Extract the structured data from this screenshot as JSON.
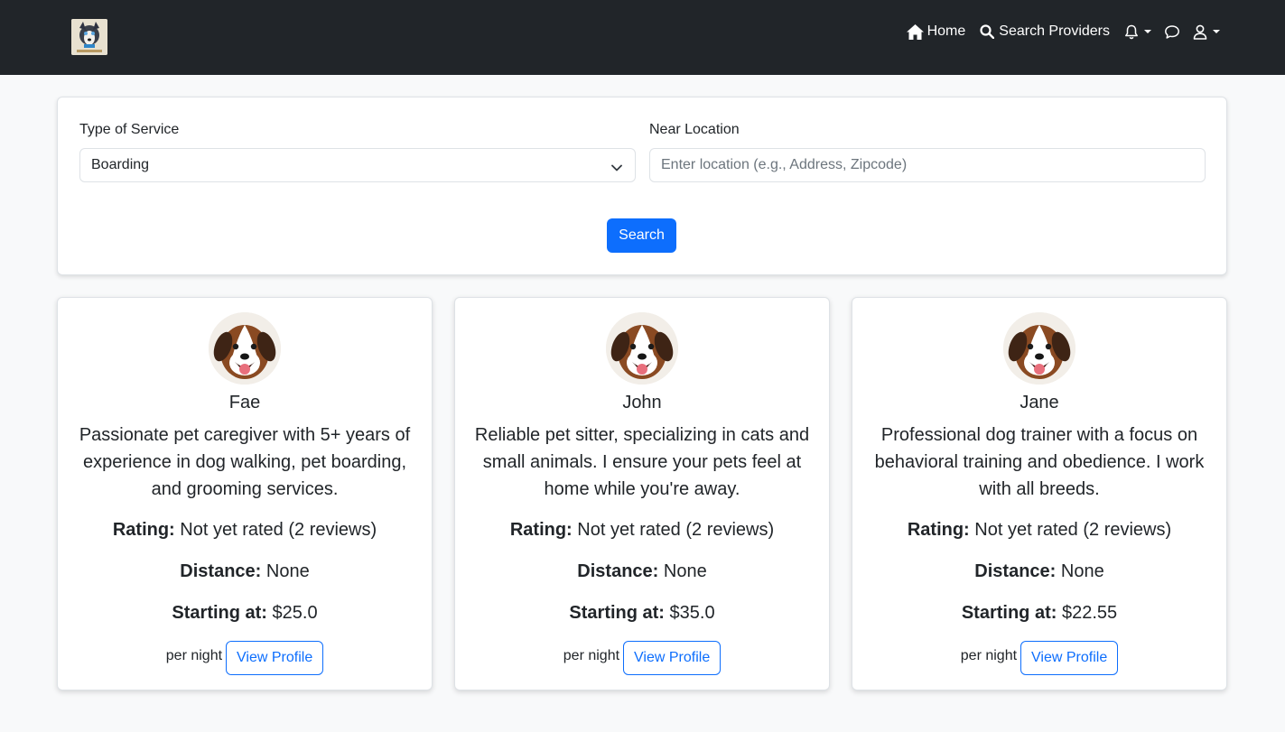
{
  "nav": {
    "home_label": "Home",
    "search_label": "Search Providers",
    "icons": [
      "home-icon",
      "search-icon",
      "bell-icon",
      "chat-icon",
      "user-icon"
    ]
  },
  "search": {
    "service_label": "Type of Service",
    "service_value": "Boarding",
    "location_label": "Near Location",
    "location_placeholder": "Enter location (e.g., Address, Zipcode)",
    "location_value": "",
    "search_button": "Search"
  },
  "labels": {
    "rating": "Rating:",
    "distance": "Distance:",
    "starting_at": "Starting at:",
    "per_night": "per night",
    "view_profile": "View Profile"
  },
  "providers": [
    {
      "name": "Fae",
      "bio": "Passionate pet caregiver with 5+ years of experience in dog walking, pet boarding, and grooming services.",
      "rating": "Not yet rated (2 reviews)",
      "distance": "None",
      "price": "$25.0"
    },
    {
      "name": "John",
      "bio": "Reliable pet sitter, specializing in cats and small animals. I ensure your pets feel at home while you're away.",
      "rating": "Not yet rated (2 reviews)",
      "distance": "None",
      "price": "$35.0"
    },
    {
      "name": "Jane",
      "bio": "Professional dog trainer with a focus on behavioral training and obedience. I work with all breeds.",
      "rating": "Not yet rated (2 reviews)",
      "distance": "None",
      "price": "$22.55"
    }
  ],
  "colors": {
    "navbar": "#212529",
    "primary": "#0d6efd",
    "page_bg": "#f8f9fa"
  }
}
